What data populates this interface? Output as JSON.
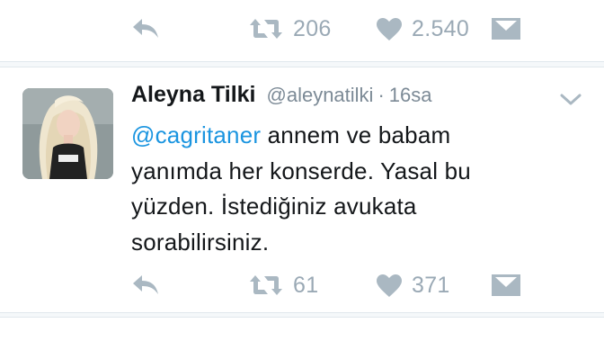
{
  "previous_tweet": {
    "actions": {
      "retweet_count": "206",
      "like_count": "2.540"
    }
  },
  "tweet": {
    "author_name": "Aleyna Tilki",
    "author_handle": "@aleynatilki",
    "separator": "·",
    "time": "16sa",
    "mention": "@cagritaner",
    "lines": [
      " annem ve babam",
      "yanımda her konserde. Yasal bu",
      "yüzden. İstediğiniz avukata",
      "sorabilirsiniz."
    ],
    "actions": {
      "retweet_count": "61",
      "like_count": "371"
    }
  },
  "icons": {
    "reply": "reply-icon",
    "retweet": "retweet-icon",
    "like": "heart-icon",
    "dm": "direct-message-icon",
    "caret": "chevron-down-icon"
  },
  "colors": {
    "icon_gray": "#aab8c2",
    "mention_blue": "#1b95e0",
    "text": "#14171a",
    "meta": "#7c8a96",
    "border": "#e1e8ed"
  }
}
